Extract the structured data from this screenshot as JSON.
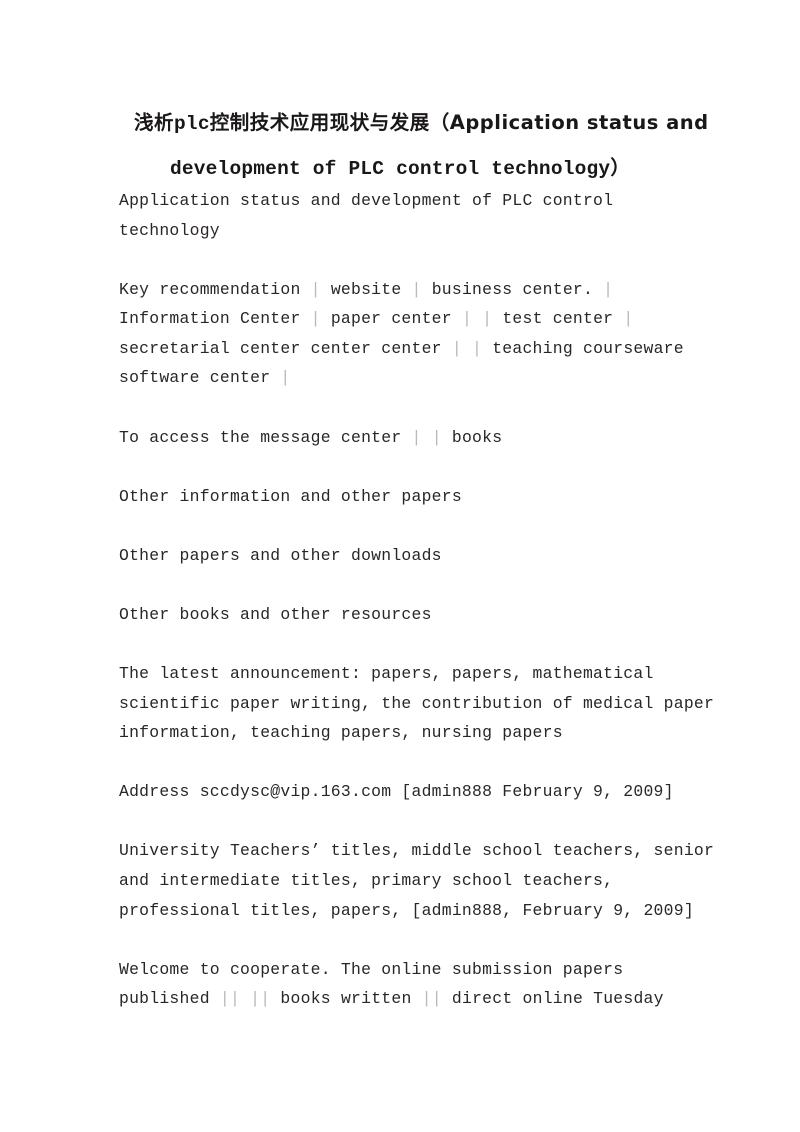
{
  "document": {
    "title": {
      "line_1_cjk": "浅析",
      "line_1_mid": "plc",
      "line_1_cjk_2": "控制技术应用现状与发展",
      "line_1_tail": "（Application status and",
      "line_2": "development of PLC control technology）",
      "full_text": "浅析plc控制技术应用现状与发展（Application status and development of PLC control technology）"
    },
    "paragraphs": [
      {
        "name": "intro-paragraph",
        "lines": [
          "Application status and development of PLC control",
          "technology"
        ]
      },
      {
        "name": "key-recommendation-paragraph",
        "lines": [
          "Key recommendation │ website │ business center. │",
          "Information Center │ paper center │ │ test center │",
          "secretarial center center center │ │ teaching courseware",
          "software center │"
        ]
      },
      {
        "name": "message-center-paragraph",
        "lines": [
          "To access the message center │ │ books"
        ]
      },
      {
        "name": "other-information-paragraph",
        "lines": [
          "Other information and other papers"
        ]
      },
      {
        "name": "other-papers-paragraph",
        "lines": [
          "Other papers and other downloads"
        ]
      },
      {
        "name": "other-books-paragraph",
        "lines": [
          "Other books and other resources"
        ]
      },
      {
        "name": "latest-announcement-paragraph",
        "lines": [
          "The latest announcement: papers, papers, mathematical",
          "scientific paper writing, the contribution of medical paper",
          "information, teaching papers, nursing papers"
        ]
      },
      {
        "name": "address-paragraph",
        "lines": [
          "Address sccdysc@vip.163.com [admin888 February 9, 2009]"
        ]
      },
      {
        "name": "teacher-titles-paragraph",
        "lines": [
          "University Teachers’ titles, middle school teachers, senior",
          "and intermediate titles, primary school teachers,",
          "professional titles, papers, [admin888, February 9, 2009]"
        ]
      },
      {
        "name": "cooperation-paragraph",
        "lines": [
          "Welcome to cooperate. The online submission papers",
          "published ││ ││ books written ││ direct online Tuesday"
        ]
      }
    ]
  },
  "colors": {
    "page_background": "#ffffff",
    "body_text": "#2a2526",
    "title_text": "#1a1718",
    "separator": "#b9b9b9"
  }
}
